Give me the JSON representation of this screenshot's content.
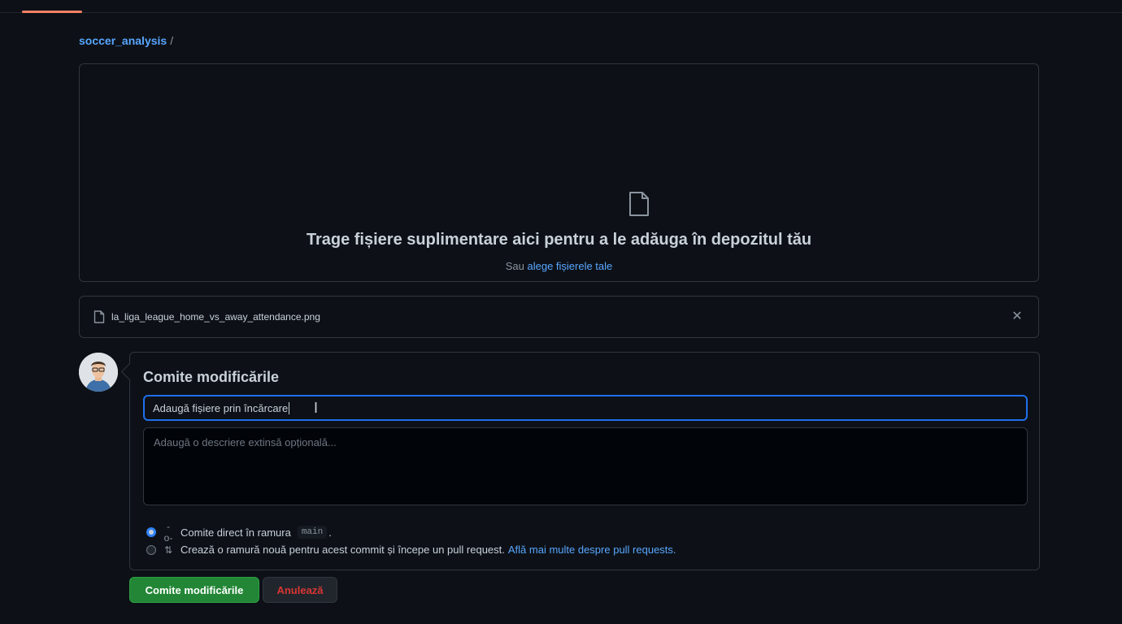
{
  "breadcrumb": {
    "repo": "soccer_analysis",
    "separator": "/"
  },
  "dropzone": {
    "icon": "file-icon",
    "title": "Trage fișiere suplimentare aici pentru a le adăuga în depozitul tău",
    "sub_prefix": "Sau",
    "choose_link": "alege fișierele tale"
  },
  "uploaded_file": {
    "icon": "file-icon",
    "name": "la_liga_league_home_vs_away_attendance.png",
    "remove_icon": "close-icon"
  },
  "commit": {
    "title": "Comite modificările",
    "summary_value": "Adaugă fișiere prin încărcare",
    "description_placeholder": "Adaugă o descriere extinsă opțională...",
    "option_direct": {
      "label": "Comite direct în ramura",
      "branch": "main",
      "suffix": ".",
      "icon": "git-commit-icon",
      "selected": true
    },
    "option_new_branch": {
      "label": "Crează o ramură nouă pentru acest commit și începe un pull request.",
      "link": "Află mai multe despre pull requests.",
      "icon": "git-pull-request-icon",
      "selected": false
    }
  },
  "buttons": {
    "commit": "Comite modificările",
    "cancel": "Anulează"
  },
  "colors": {
    "background": "#0d1117",
    "accent_link": "#58a6ff",
    "focus_border": "#1f6feb",
    "commit_green": "#238636",
    "cancel_red": "#da3633",
    "tab_underline": "#f78166"
  }
}
